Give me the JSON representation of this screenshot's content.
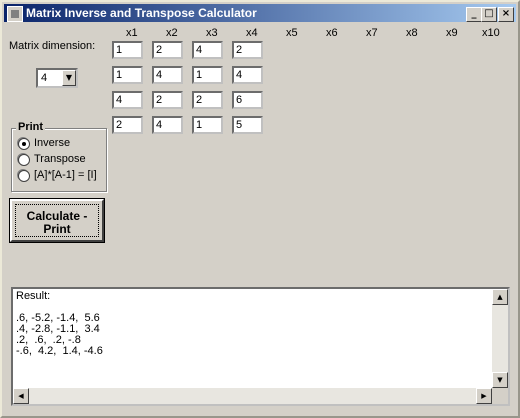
{
  "window": {
    "title": "Matrix Inverse and Transpose Calculator"
  },
  "title_buttons": {
    "minimize": "_",
    "maximize": "□",
    "close": "×"
  },
  "dimension": {
    "label": "Matrix dimension:",
    "value": "4"
  },
  "columns": [
    "x1",
    "x2",
    "x3",
    "x4",
    "x5",
    "x6",
    "x7",
    "x8",
    "x9",
    "x10"
  ],
  "matrix": [
    [
      "1",
      "2",
      "4",
      "2"
    ],
    [
      "1",
      "4",
      "1",
      "4"
    ],
    [
      "4",
      "2",
      "2",
      "6"
    ],
    [
      "2",
      "4",
      "1",
      "5"
    ]
  ],
  "print_group": {
    "label": "Print",
    "options": [
      {
        "label": "Inverse",
        "checked": true
      },
      {
        "label": "Transpose",
        "checked": false
      },
      {
        "label": "[A]*[A-1] = [I]",
        "checked": false
      }
    ]
  },
  "calculate_button": {
    "line1": "Calculate -",
    "line2": "Print"
  },
  "result": {
    "text": "Result:\n\n.6, -5.2, -1.4,  5.6\n.4, -2.8, -1.1,  3.4\n.2,  .6,  .2, -.8\n-.6,  4.2,  1.4, -4.6"
  },
  "icons": {
    "combo_arrow": "chevron-down-icon",
    "scroll_up": "arrow-up-icon",
    "scroll_down": "arrow-down-icon",
    "scroll_left": "arrow-left-icon",
    "scroll_right": "arrow-right-icon"
  },
  "colors": {
    "titlebar_start": "#0a246a",
    "titlebar_end": "#a6caf0",
    "face": "#d4d0c8"
  }
}
